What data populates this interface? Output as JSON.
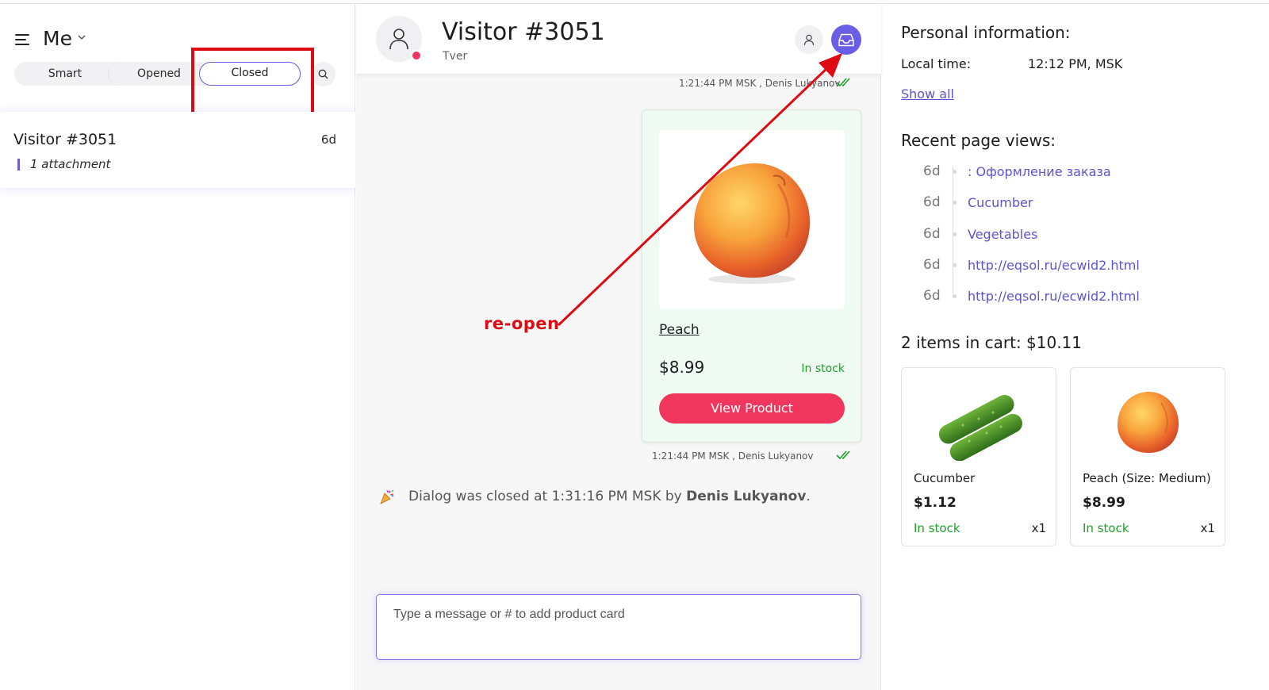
{
  "sidebar": {
    "owner_label": "Me",
    "tabs": [
      {
        "label": "Smart"
      },
      {
        "label": "Opened"
      },
      {
        "label": "Closed",
        "active": true
      }
    ],
    "conversations": [
      {
        "name": "Visitor #3051",
        "time": "6d",
        "preview": "1 attachment"
      }
    ]
  },
  "chat": {
    "visitor_name": "Visitor #3051",
    "visitor_city": "Tver",
    "status_color": "#f0365c",
    "messages_meta": [
      {
        "text": "1:21:44 PM MSK , Denis Lukyanov"
      },
      {
        "text": "1:21:44 PM MSK , Denis Lukyanov"
      }
    ],
    "product_card": {
      "name": "Peach",
      "price": "$8.99",
      "stock": "In stock",
      "button_label": "View Product"
    },
    "closed_note": {
      "prefix": "Dialog was closed at 1:31:16 PM MSK by ",
      "agent": "Denis Lukyanov",
      "suffix": "."
    },
    "composer_placeholder": "Type a message or # to add product card"
  },
  "annotation": {
    "label": "re-open",
    "color": "#dc0c12"
  },
  "info": {
    "personal_title": "Personal information:",
    "local_time_label": "Local time:",
    "local_time_value": "12:12 PM, MSK",
    "show_all": "Show all",
    "recent_title": "Recent page views:",
    "page_views": [
      {
        "time": "6d",
        "title": ": Оформление заказа"
      },
      {
        "time": "6d",
        "title": "Cucumber"
      },
      {
        "time": "6d",
        "title": "Vegetables"
      },
      {
        "time": "6d",
        "title": "http://eqsol.ru/ecwid2.html"
      },
      {
        "time": "6d",
        "title": "http://eqsol.ru/ecwid2.html"
      }
    ],
    "cart_title": "2 items in cart: $10.11",
    "cart_items": [
      {
        "name": "Cucumber",
        "price": "$1.12",
        "stock": "In stock",
        "qty": "x1"
      },
      {
        "name": "Peach (Size: Medium)",
        "price": "$8.99",
        "stock": "In stock",
        "qty": "x1"
      }
    ]
  },
  "colors": {
    "accent": "#6a5de6",
    "danger": "#f0365c",
    "in_stock": "#1f9f2a",
    "link": "#5b55cf"
  },
  "icons": [
    "menu-icon",
    "chevron-down-icon",
    "search-icon",
    "user-icon",
    "inbox-icon",
    "double-check-icon",
    "party-popper-icon"
  ]
}
